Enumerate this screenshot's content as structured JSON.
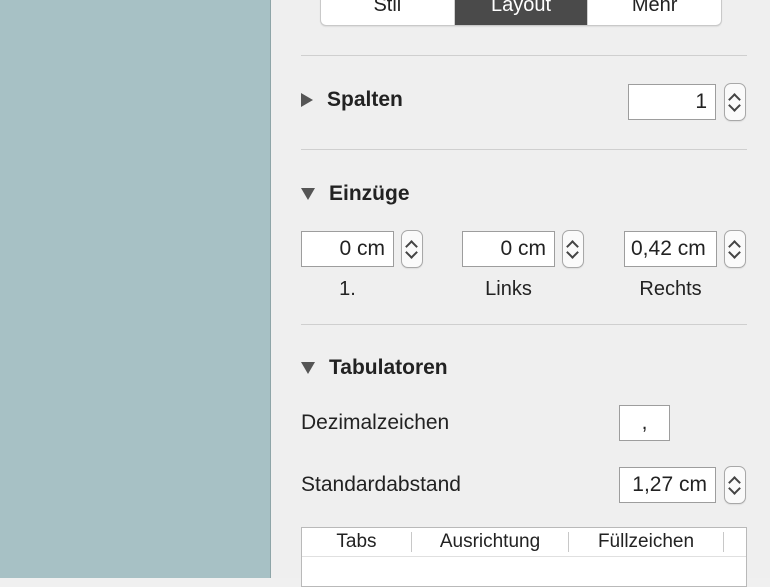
{
  "segmented_tabs": [
    {
      "label": "Stil",
      "active": false
    },
    {
      "label": "Layout",
      "active": true
    },
    {
      "label": "Mehr",
      "active": false
    }
  ],
  "sections": {
    "spalten": {
      "title": "Spalten",
      "expanded": false,
      "value": "1"
    },
    "einzuege": {
      "title": "Einzüge",
      "expanded": true,
      "fields": [
        {
          "value": "0 cm",
          "label": "1."
        },
        {
          "value": "0 cm",
          "label": "Links"
        },
        {
          "value": "0,42 cm",
          "label": "Rechts"
        }
      ]
    },
    "tabulatoren": {
      "title": "Tabulatoren",
      "expanded": true,
      "dezimalzeichen_label": "Dezimalzeichen",
      "dezimalzeichen_value": ",",
      "standardabstand_label": "Standardabstand",
      "standardabstand_value": "1,27 cm",
      "table_headers": [
        "Tabs",
        "Ausrichtung",
        "Füllzeichen"
      ]
    }
  },
  "colors": {
    "canvas": "#a7c1c5",
    "panel": "#efefef",
    "active_segment": "#4a4a4a"
  }
}
